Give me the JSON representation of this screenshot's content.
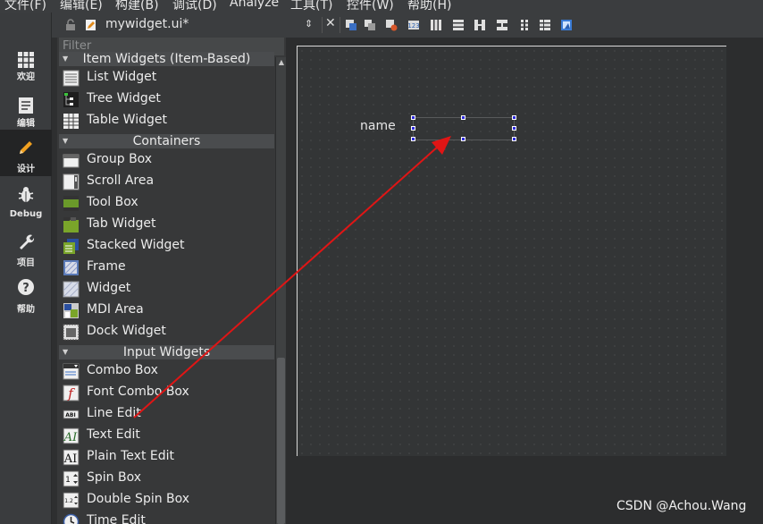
{
  "menubar": {
    "items": [
      {
        "label": "文件(F)"
      },
      {
        "label": "编辑(E)"
      },
      {
        "label": "构建(B)"
      },
      {
        "label": "调试(D)"
      },
      {
        "label": "Analyze"
      },
      {
        "label": "工具(T)"
      },
      {
        "label": "控件(W)"
      },
      {
        "label": "帮助(H)"
      }
    ]
  },
  "modes": [
    {
      "label": "欢迎",
      "icon": "grid-icon"
    },
    {
      "label": "编辑",
      "icon": "document-icon"
    },
    {
      "label": "设计",
      "icon": "pencil-icon",
      "active": true
    },
    {
      "label": "Debug",
      "icon": "bug-icon"
    },
    {
      "label": "项目",
      "icon": "wrench-icon"
    },
    {
      "label": "帮助",
      "icon": "help-icon"
    }
  ],
  "document": {
    "title": "mywidget.ui*"
  },
  "widgetbox": {
    "filter_placeholder": "Filter",
    "partial_category": "Item Widgets (Item-Based)",
    "item_based": [
      {
        "label": "List Widget",
        "icon": "list-widget-icon"
      },
      {
        "label": "Tree Widget",
        "icon": "tree-widget-icon"
      },
      {
        "label": "Table Widget",
        "icon": "table-widget-icon"
      }
    ],
    "containers_title": "Containers",
    "containers": [
      {
        "label": "Group Box",
        "icon": "group-box-icon"
      },
      {
        "label": "Scroll Area",
        "icon": "scroll-area-icon"
      },
      {
        "label": "Tool Box",
        "icon": "tool-box-icon"
      },
      {
        "label": "Tab Widget",
        "icon": "tab-widget-icon"
      },
      {
        "label": "Stacked Widget",
        "icon": "stacked-widget-icon"
      },
      {
        "label": "Frame",
        "icon": "frame-icon"
      },
      {
        "label": "Widget",
        "icon": "widget-icon"
      },
      {
        "label": "MDI Area",
        "icon": "mdi-area-icon"
      },
      {
        "label": "Dock Widget",
        "icon": "dock-widget-icon"
      }
    ],
    "input_title": "Input Widgets",
    "input": [
      {
        "label": "Combo Box",
        "icon": "combo-box-icon"
      },
      {
        "label": "Font Combo Box",
        "icon": "font-combo-box-icon"
      },
      {
        "label": "Line Edit",
        "icon": "line-edit-icon"
      },
      {
        "label": "Text Edit",
        "icon": "text-edit-icon"
      },
      {
        "label": "Plain Text Edit",
        "icon": "plain-text-edit-icon"
      },
      {
        "label": "Spin Box",
        "icon": "spin-box-icon"
      },
      {
        "label": "Double Spin Box",
        "icon": "double-spin-box-icon"
      },
      {
        "label": "Time Edit",
        "icon": "time-edit-icon"
      }
    ]
  },
  "form": {
    "label_text": "name"
  },
  "annotation": {
    "arrow_color": "#e01515"
  },
  "watermark": "CSDN @Achou.Wang"
}
